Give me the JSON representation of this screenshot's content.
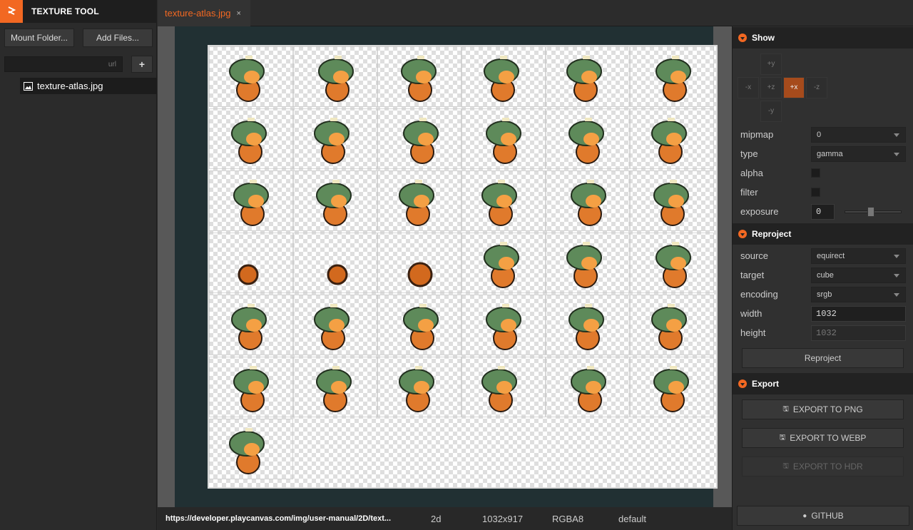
{
  "app": {
    "title": "TEXTURE TOOL"
  },
  "left_panel": {
    "mount_label": "Mount Folder...",
    "add_label": "Add Files...",
    "url_placeholder": "url",
    "plus_label": "+",
    "files": [
      {
        "name": "texture-atlas.jpg"
      }
    ]
  },
  "tabs": [
    {
      "label": "texture-atlas.jpg",
      "close": "×"
    }
  ],
  "status": {
    "url": "https://developer.playcanvas.com/img/user-manual/2D/text...",
    "mode": "2d",
    "size": "1032x917",
    "format": "RGBA8",
    "cubemap": "default"
  },
  "show": {
    "title": "Show",
    "faces": [
      "+y",
      "-x",
      "+z",
      "+x",
      "-z",
      "-y"
    ],
    "active_face": "+x",
    "mipmap_label": "mipmap",
    "mipmap_value": "0",
    "type_label": "type",
    "type_value": "gamma",
    "alpha_label": "alpha",
    "filter_label": "filter",
    "exposure_label": "exposure",
    "exposure_value": "0"
  },
  "reproject": {
    "title": "Reproject",
    "source_label": "source",
    "source_value": "equirect",
    "target_label": "target",
    "target_value": "cube",
    "encoding_label": "encoding",
    "encoding_value": "srgb",
    "width_label": "width",
    "width_value": "1032",
    "height_label": "height",
    "height_value": "1032",
    "button_label": "Reproject"
  },
  "export": {
    "title": "Export",
    "png_label": "EXPORT TO PNG",
    "webp_label": "EXPORT TO WEBP",
    "hdr_label": "EXPORT TO HDR",
    "github_label": "GITHUB"
  },
  "colors": {
    "accent": "#f26822",
    "panel": "#303030",
    "header": "#222222"
  }
}
